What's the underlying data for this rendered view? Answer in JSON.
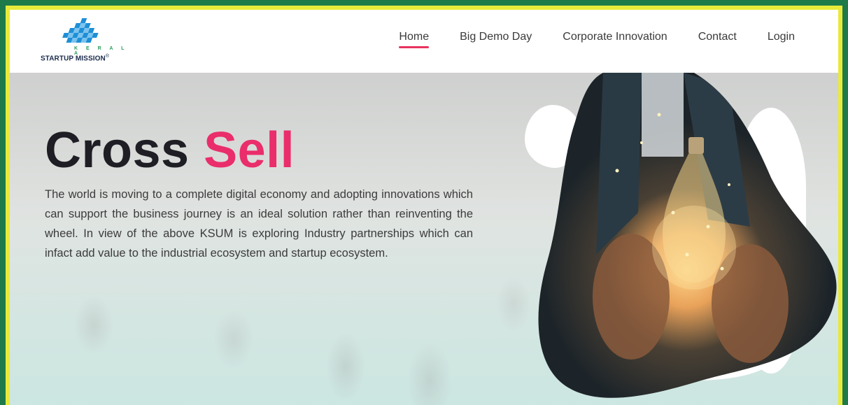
{
  "logo": {
    "kerala": "K E R A L A",
    "name": "STARTUP MISSION",
    "registered": "®"
  },
  "nav": {
    "items": [
      {
        "label": "Home",
        "active": true
      },
      {
        "label": "Big Demo Day",
        "active": false
      },
      {
        "label": "Corporate Innovation",
        "active": false
      },
      {
        "label": "Contact",
        "active": false
      },
      {
        "label": "Login",
        "active": false
      }
    ]
  },
  "hero": {
    "title_main": "Cross",
    "title_accent": "Sell",
    "description": "The world is moving to a complete digital economy and adopting innovations which can support the business journey is an ideal solution rather than reinventing the wheel. In view of the above KSUM is exploring Industry partnerships which can infact add value to the industrial ecosystem and startup ecosystem."
  },
  "colors": {
    "outer_border": "#1f7a4a",
    "inner_border": "#e8ea3a",
    "accent": "#ea2d6b",
    "title": "#1e1e24",
    "logo_green": "#2a9d5c",
    "logo_blue": "#1e8fd6"
  }
}
